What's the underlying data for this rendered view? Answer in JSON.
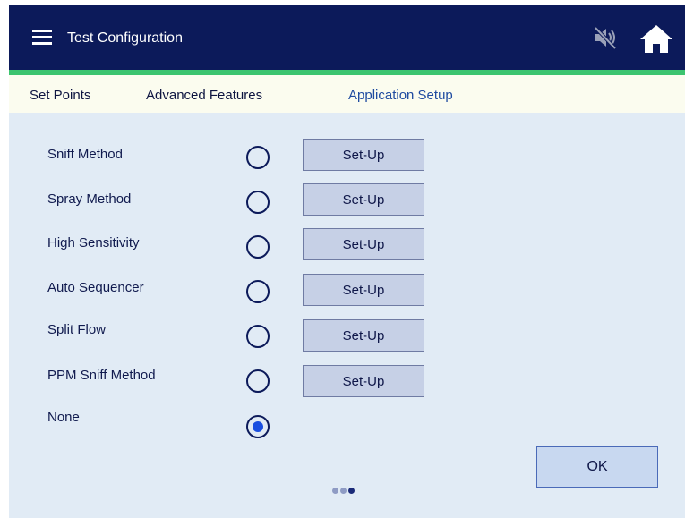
{
  "header": {
    "title": "Test Configuration",
    "menu_icon": "hamburger-menu-icon",
    "mute_icon": "speaker-muted-icon",
    "home_icon": "home-icon",
    "background_color": "#0c1a5a",
    "accent_color": "#3cc46f"
  },
  "tabs": [
    {
      "label": "Set Points",
      "active": false
    },
    {
      "label": "Advanced Features",
      "active": false
    },
    {
      "label": "Application Setup",
      "active": true
    }
  ],
  "methods": [
    {
      "label": "Sniff Method",
      "selected": false,
      "button_label": "Set-Up"
    },
    {
      "label": "Spray Method",
      "selected": false,
      "button_label": "Set-Up"
    },
    {
      "label": "High Sensitivity",
      "selected": false,
      "button_label": "Set-Up"
    },
    {
      "label": "Auto Sequencer",
      "selected": false,
      "button_label": "Set-Up"
    },
    {
      "label": "Split Flow",
      "selected": false,
      "button_label": "Set-Up"
    },
    {
      "label": "PPM Sniff Method",
      "selected": false,
      "button_label": "Set-Up"
    },
    {
      "label": "None",
      "selected": true,
      "button_label": ""
    }
  ],
  "ok_button": {
    "label": "OK"
  },
  "pagination": {
    "page_count": 3,
    "current_page": 3
  }
}
